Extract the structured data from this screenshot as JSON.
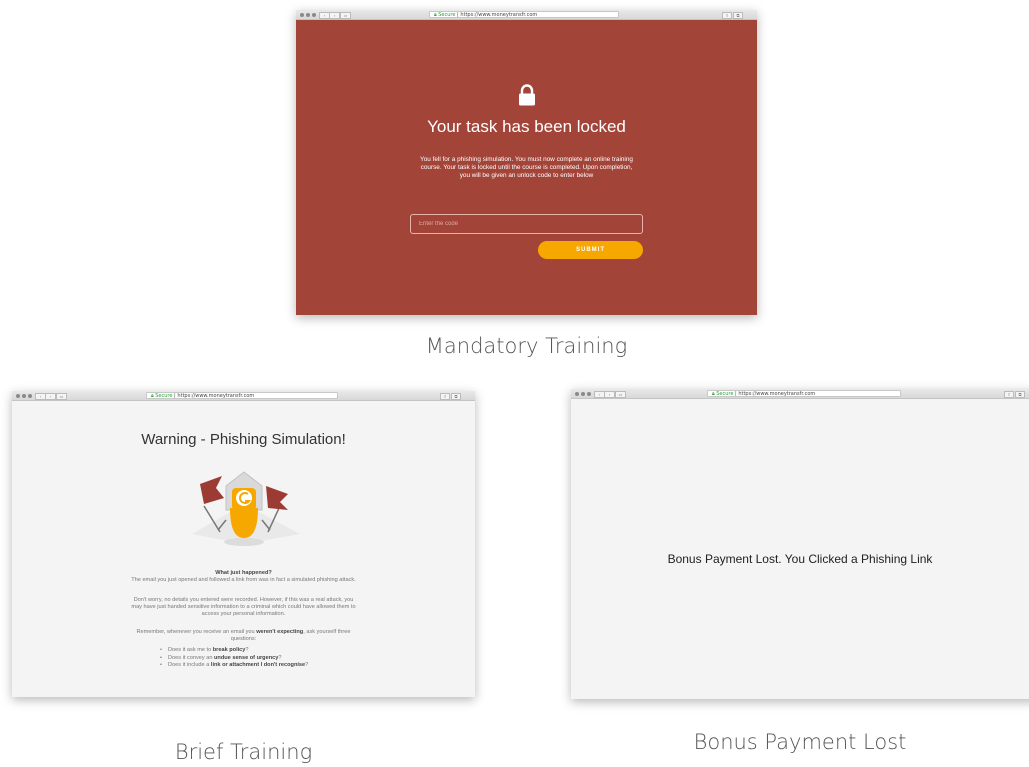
{
  "browser": {
    "url_secure": "Secure",
    "url_text": "https://www.moneytransfr.com"
  },
  "locked_window": {
    "title": "Your task has been locked",
    "message": "You fell for a phishing simulation. You must now complete an online training course. Your task is locked until the course is completed. Upon completion, you will be given an unlock code to enter below",
    "code_placeholder": "Enter the code",
    "submit_label": "SUBMIT",
    "background_color": "#a34439",
    "button_color": "#f6a800"
  },
  "warning_window": {
    "title": "Warning - Phishing Simulation!",
    "heading": "What just happened?",
    "para1": "The email you just opened and followed a link from was in fact a simulated phishing attack.",
    "para2": "Don't worry, no details you entered were recorded. However, if this was a real attack, you may have just handed sensitive information to a criminal which could have allowed them to access your personal information.",
    "para3_prefix": "Remember, whenever you receive an email you ",
    "para3_bold": "weren't expecting",
    "para3_suffix": ", ask yourself three questions:",
    "questions": [
      {
        "prefix": "Does it ask me to ",
        "bold": "break policy",
        "suffix": "?"
      },
      {
        "prefix": "Does it convey an ",
        "bold": "undue sense of urgency",
        "suffix": "?"
      },
      {
        "prefix": "Does it include a ",
        "bold": "link or attachment I don't recognise",
        "suffix": "?"
      }
    ]
  },
  "bonus_window": {
    "message": "Bonus Payment Lost. You Clicked a Phishing Link"
  },
  "captions": {
    "mandatory": "Mandatory Training",
    "brief": "Brief Training",
    "bonus": "Bonus Payment Lost"
  }
}
